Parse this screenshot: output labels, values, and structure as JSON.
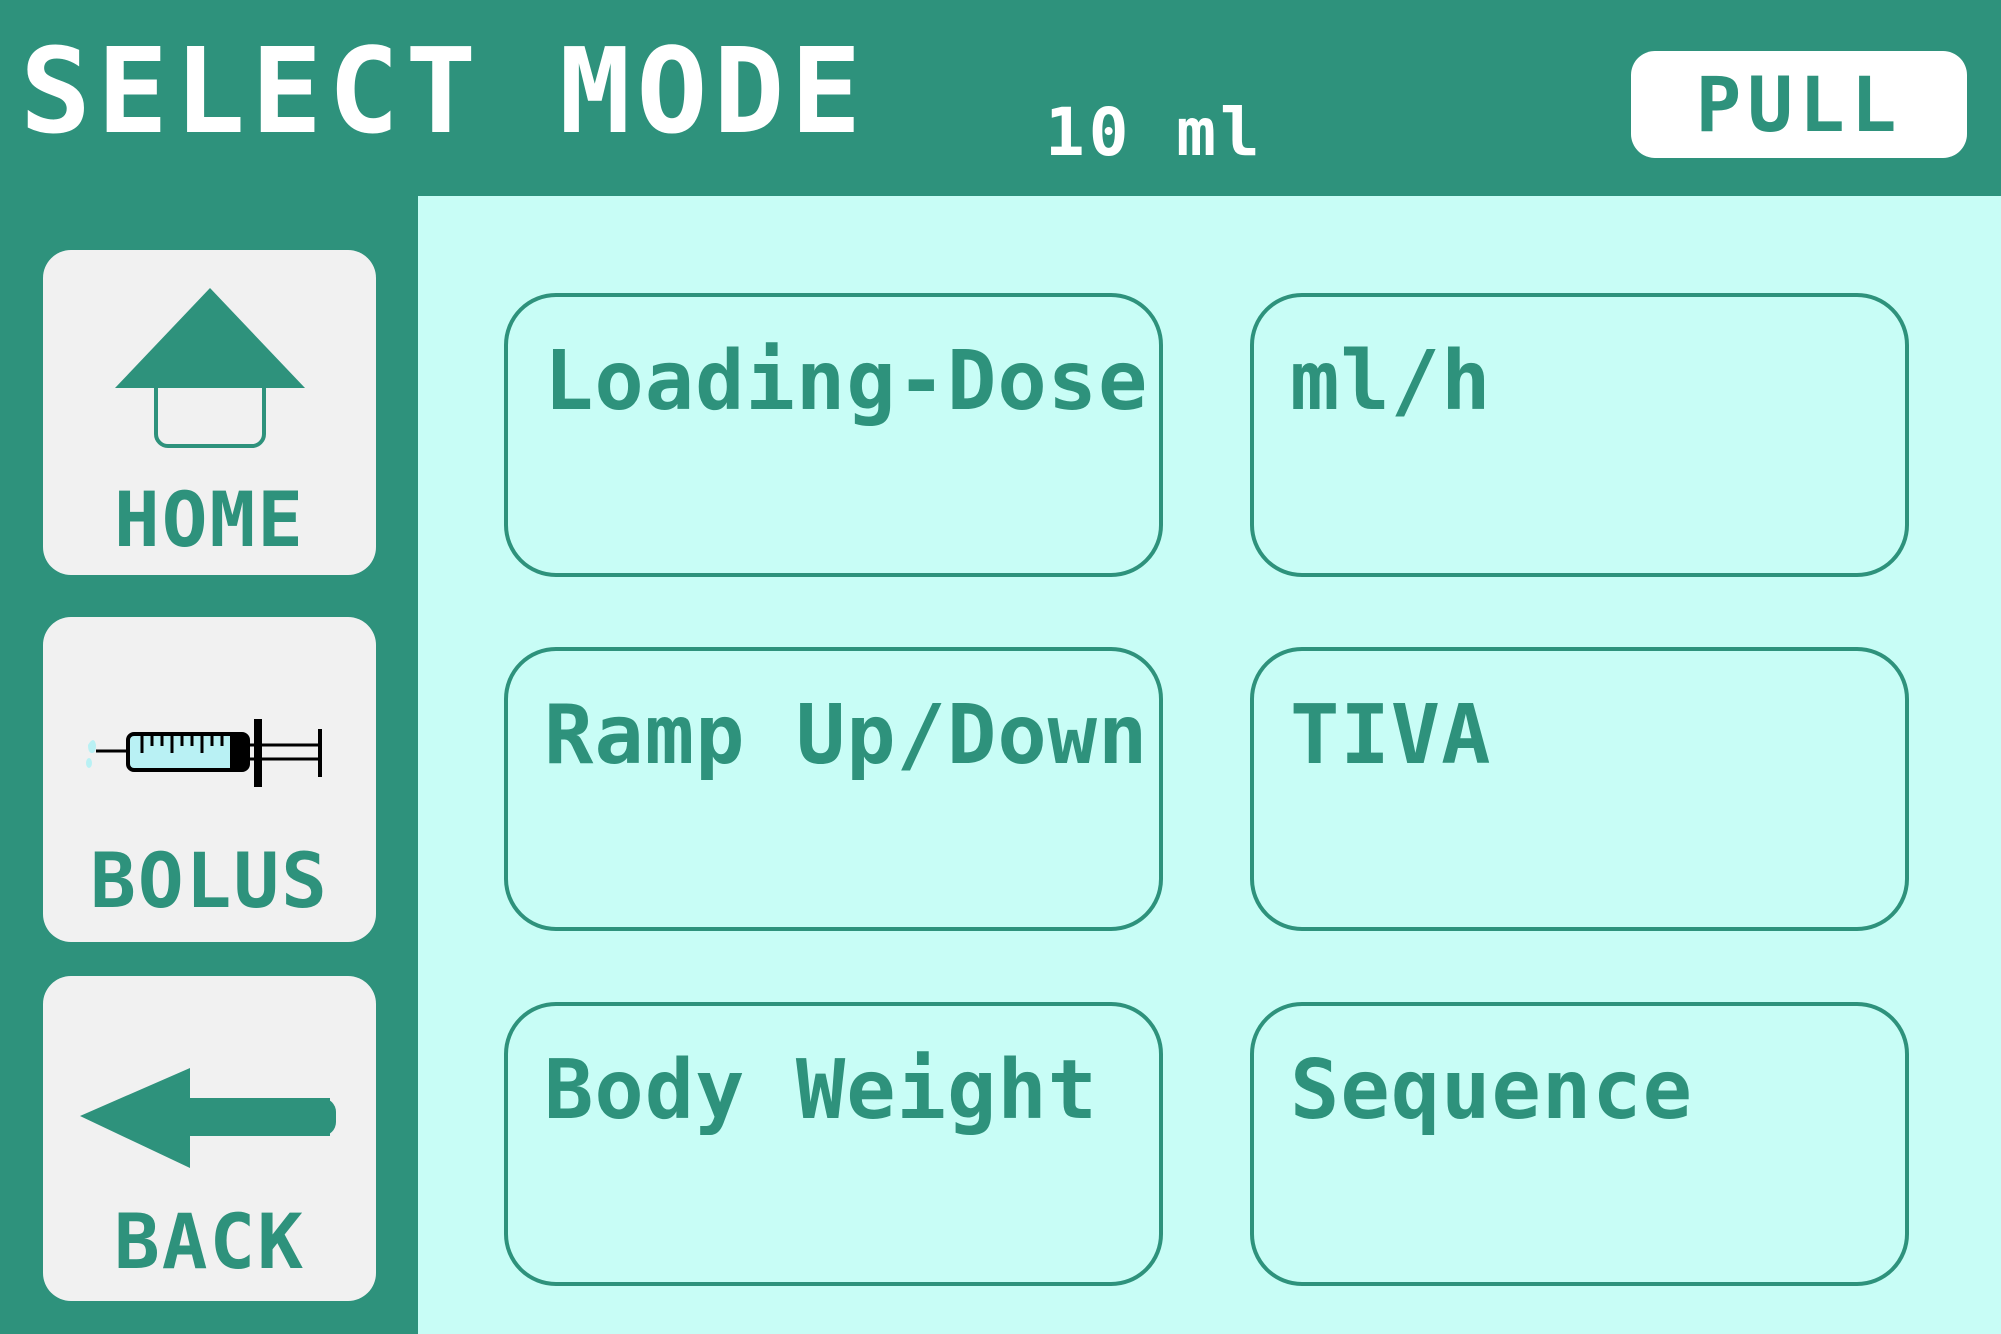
{
  "header": {
    "title": "SELECT MODE",
    "volume": "10 ml",
    "pull_label": "PULL"
  },
  "sidebar": {
    "items": [
      {
        "label": "HOME",
        "icon": "home-icon"
      },
      {
        "label": "BOLUS",
        "icon": "syringe-icon"
      },
      {
        "label": "BACK",
        "icon": "back-arrow-icon"
      }
    ]
  },
  "modes": [
    {
      "label": "Loading-Dose"
    },
    {
      "label": "ml/h"
    },
    {
      "label": "Ramp Up/Down"
    },
    {
      "label": "TIVA"
    },
    {
      "label": "Body Weight"
    },
    {
      "label": "Sequence"
    }
  ],
  "colors": {
    "primary": "#2e927c",
    "panel": "#c8fdf6",
    "button_bg": "#f1f1f1",
    "white": "#ffffff",
    "syringe_fluid": "#b9f1f4"
  }
}
